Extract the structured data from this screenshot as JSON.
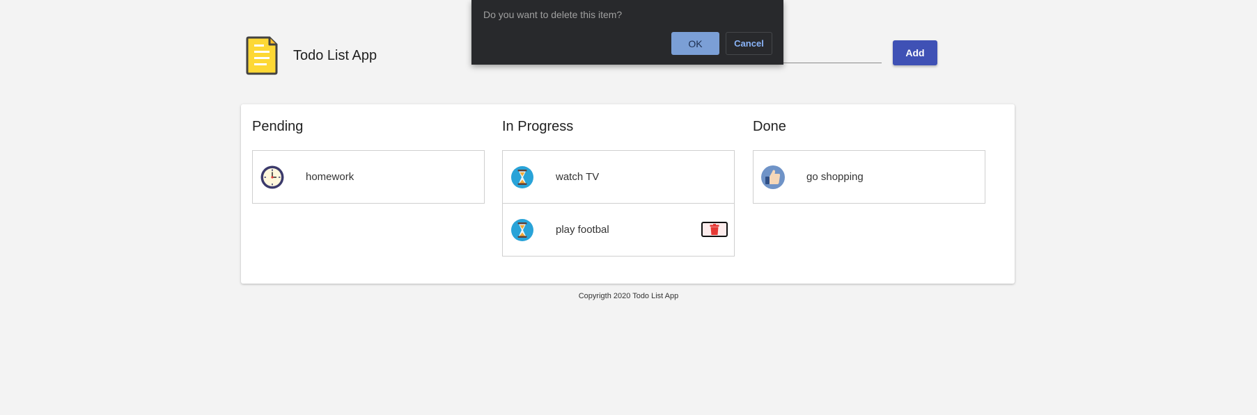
{
  "app": {
    "title": "Todo List App"
  },
  "new_item": {
    "value": "",
    "placeholder": "",
    "add_label": "Add"
  },
  "columns": [
    {
      "title": "Pending",
      "tasks": [
        {
          "label": "homework",
          "icon": "clock-icon"
        }
      ]
    },
    {
      "title": "In Progress",
      "tasks": [
        {
          "label": "watch TV",
          "icon": "hourglass-icon"
        },
        {
          "label": "play footbal",
          "icon": "hourglass-icon"
        }
      ]
    },
    {
      "title": "Done",
      "tasks": [
        {
          "label": "go shopping",
          "icon": "thumbs-up-icon"
        }
      ]
    }
  ],
  "dialog": {
    "message": "Do you want to delete this item?",
    "ok_label": "OK",
    "cancel_label": "Cancel"
  },
  "footer": {
    "text": "Copyrigth 2020 Todo List App"
  },
  "colors": {
    "primary": "#3f51b5",
    "dialog_bg": "#28292c",
    "delete_red": "#e53935"
  }
}
